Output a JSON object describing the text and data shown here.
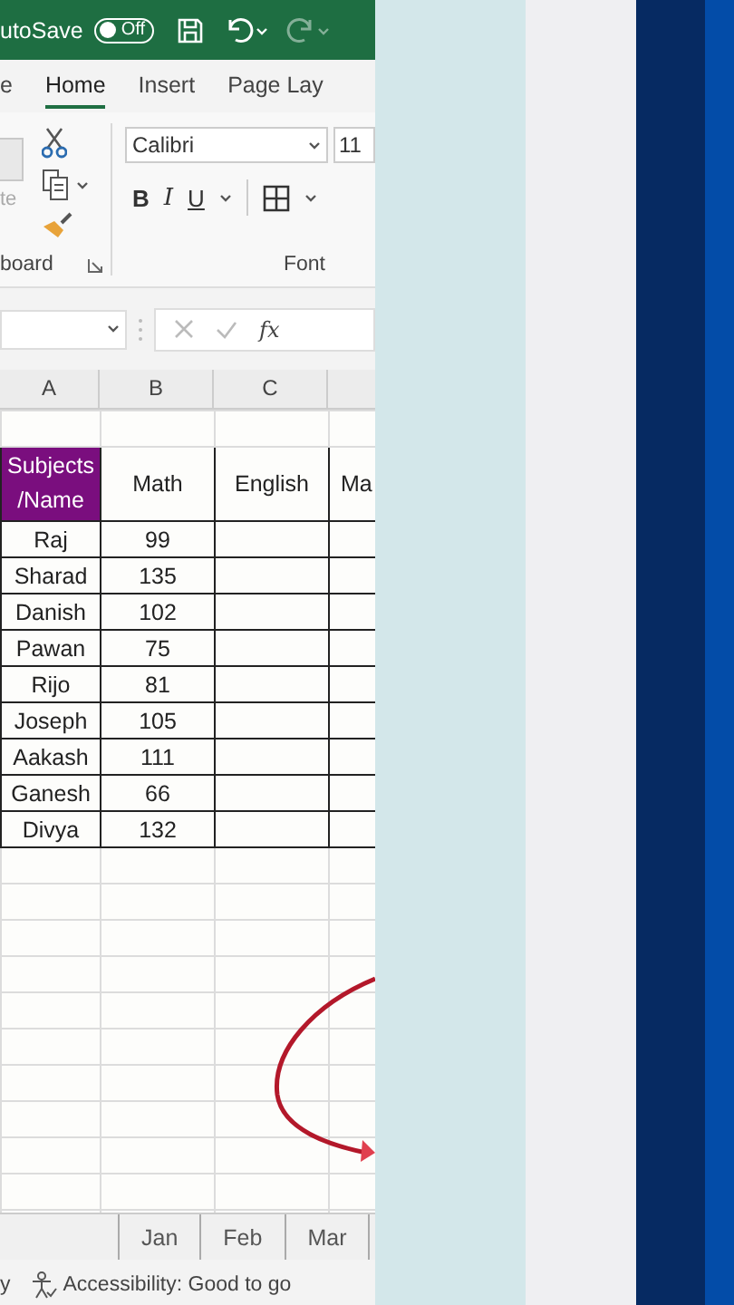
{
  "title_bar": {
    "autosave_label": "utoSave",
    "autosave_on": false,
    "toggle_text": "Off"
  },
  "ribbon_tabs": [
    {
      "label": "e",
      "selected": false
    },
    {
      "label": "Home",
      "selected": true
    },
    {
      "label": "Insert",
      "selected": false
    },
    {
      "label": "Page Lay",
      "selected": false
    }
  ],
  "clipboard": {
    "paste_label": "te",
    "group_label": "board"
  },
  "font": {
    "name": "Calibri",
    "size": "11",
    "group_label": "Font",
    "format_buttons": [
      "B",
      "I",
      "U"
    ]
  },
  "formula_bar": {
    "fx": "fx"
  },
  "columns": [
    "A",
    "B",
    "C"
  ],
  "table": {
    "headers": [
      "Subjects\n/Name",
      "Math",
      "English",
      "Ma"
    ],
    "rows": [
      {
        "name": "Raj",
        "math": "99"
      },
      {
        "name": "Sharad",
        "math": "135"
      },
      {
        "name": "Danish",
        "math": "102"
      },
      {
        "name": "Pawan",
        "math": "75"
      },
      {
        "name": "Rijo",
        "math": "81"
      },
      {
        "name": "Joseph",
        "math": "105"
      },
      {
        "name": "Aakash",
        "math": "111"
      },
      {
        "name": "Ganesh",
        "math": "66"
      },
      {
        "name": "Divya",
        "math": "132"
      }
    ]
  },
  "sheet_tabs": [
    {
      "label": "Jan",
      "selected": false
    },
    {
      "label": "Feb",
      "selected": false
    },
    {
      "label": "Mar",
      "selected": false
    }
  ],
  "status_bar": {
    "left": "y",
    "accessibility": "Accessibility: Good to go"
  }
}
